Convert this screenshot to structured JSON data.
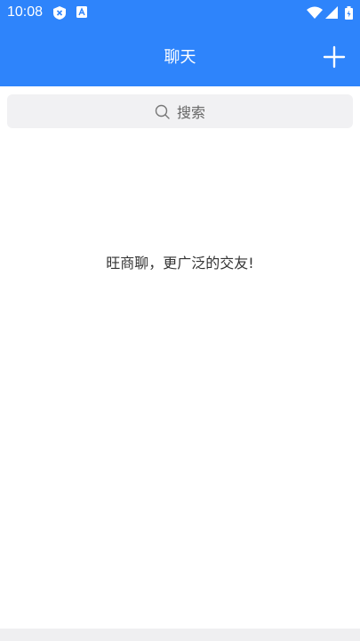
{
  "status_bar": {
    "time": "10:08",
    "icons": [
      "shield-icon",
      "a-badge-icon",
      "wifi-icon",
      "signal-icon",
      "battery-icon"
    ]
  },
  "header": {
    "title": "聊天",
    "add_icon": "plus-icon",
    "background": "#2e84fb"
  },
  "search": {
    "placeholder": "搜索",
    "icon": "search-icon"
  },
  "main": {
    "empty_message": "旺商聊，更广泛的交友!"
  }
}
